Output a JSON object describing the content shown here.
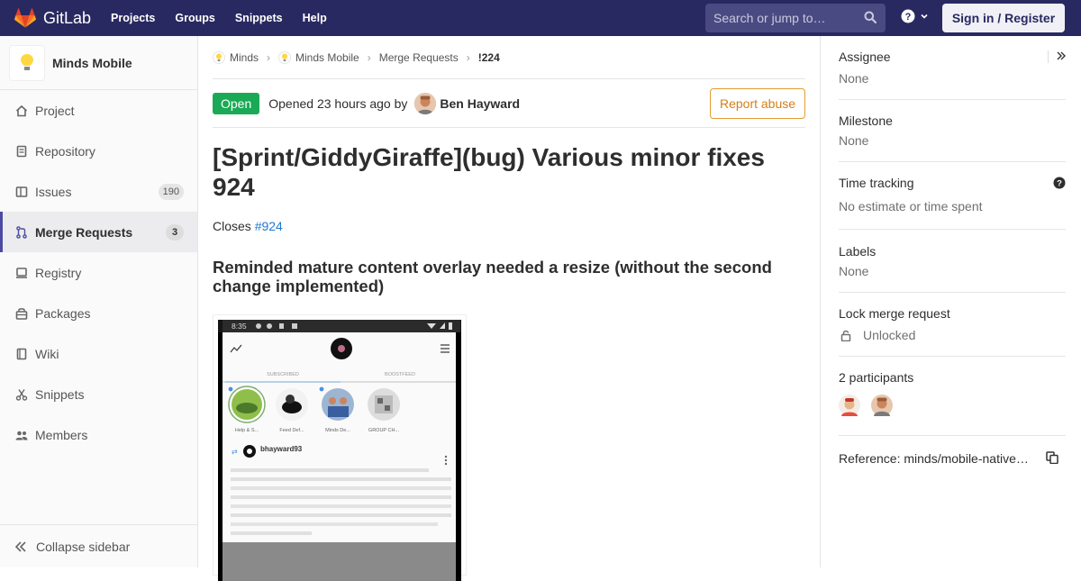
{
  "topbar": {
    "brand": "GitLab",
    "nav": [
      "Projects",
      "Groups",
      "Snippets",
      "Help"
    ],
    "search_placeholder": "Search or jump to…",
    "signin": "Sign in / Register"
  },
  "sidebar": {
    "project_name": "Minds Mobile",
    "items": [
      {
        "label": "Project",
        "icon": "home-icon"
      },
      {
        "label": "Repository",
        "icon": "doc-icon"
      },
      {
        "label": "Issues",
        "icon": "issues-icon",
        "count": "190"
      },
      {
        "label": "Merge Requests",
        "icon": "merge-icon",
        "count": "3",
        "active": true
      },
      {
        "label": "Registry",
        "icon": "registry-icon"
      },
      {
        "label": "Packages",
        "icon": "package-icon"
      },
      {
        "label": "Wiki",
        "icon": "book-icon"
      },
      {
        "label": "Snippets",
        "icon": "scissors-icon"
      },
      {
        "label": "Members",
        "icon": "users-icon"
      }
    ],
    "collapse": "Collapse sidebar"
  },
  "breadcrumb": {
    "group": "Minds",
    "project": "Minds Mobile",
    "section": "Merge Requests",
    "current": "!224"
  },
  "mr": {
    "status": "Open",
    "opened": "Opened 23 hours ago by",
    "author": "Ben Hayward",
    "report": "Report abuse",
    "title": "[Sprint/GiddyGiraffe](bug) Various minor fixes 924",
    "closes_prefix": "Closes",
    "closes_link": "#924",
    "heading": "Reminded mature content overlay needed a resize (without the second change implemented)"
  },
  "screenshot": {
    "time": "8:35",
    "tab_subscribed": "SUBSCRIBED",
    "tab_boostfeed": "BOOSTFEED",
    "avatars": [
      "Help & S...",
      "Feed Def...",
      "Minds De...",
      "GROUP CH..."
    ],
    "username": "bhayward93"
  },
  "right": {
    "assignee_label": "Assignee",
    "assignee_value": "None",
    "milestone_label": "Milestone",
    "milestone_value": "None",
    "time_label": "Time tracking",
    "time_value": "No estimate or time spent",
    "labels_label": "Labels",
    "labels_value": "None",
    "lock_label": "Lock merge request",
    "lock_value": "Unlocked",
    "participants": "2 participants",
    "reference": "Reference: minds/mobile-native…"
  },
  "colors": {
    "topbar": "#292961",
    "open": "#1aaa55",
    "report": "#e39b33",
    "link": "#1f78d1"
  }
}
